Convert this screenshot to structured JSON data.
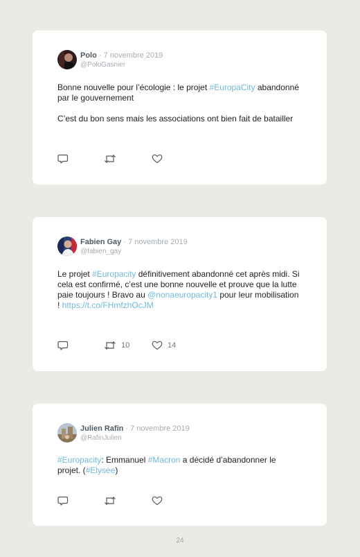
{
  "tweets": [
    {
      "name": "Polo",
      "date": "7 novembre 2019",
      "handle": "@PoloGasnier",
      "paragraphs": [
        [
          {
            "t": "Bonne nouvelle pour l’écologie : le projet "
          },
          {
            "t": "#EuropaCity",
            "link": true
          },
          {
            "t": " abandonné par le gouvernement"
          }
        ],
        [
          {
            "t": "C’est du bon sens mais les associations ont bien fait de batailler"
          }
        ]
      ],
      "retweets": "",
      "likes": ""
    },
    {
      "name": "Fabien Gay",
      "date": "7 novembre 2019",
      "handle": "@fabien_gay",
      "paragraphs": [
        [
          {
            "t": "Le projet "
          },
          {
            "t": "#Europacity",
            "link": true
          },
          {
            "t": " définitivement abandonné cet après midi. Si cela est confirmé, c’est une bonne nouvelle et prouve que la lutte paie toujours ! Bravo au "
          },
          {
            "t": "@nonaeuropacity1",
            "link": true
          },
          {
            "t": " pour leur mobilisation ! "
          },
          {
            "t": "https://t.co/FHmfzhOcJM",
            "link": true
          }
        ]
      ],
      "retweets": "10",
      "likes": "14"
    },
    {
      "name": "Julien Rafin",
      "date": "7 novembre 2019",
      "handle": "@RafinJulien",
      "paragraphs": [
        [
          {
            "t": "#Europacity",
            "link": true
          },
          {
            "t": ": Emmanuel "
          },
          {
            "t": "#Macron",
            "link": true
          },
          {
            "t": " a décidé d’abandonner le projet. ("
          },
          {
            "t": "#Elysée",
            "link": true
          },
          {
            "t": ")"
          }
        ]
      ],
      "retweets": "",
      "likes": ""
    }
  ],
  "separator": "·",
  "page_number": "24",
  "icons": {
    "reply": "reply-icon",
    "retweet": "retweet-icon",
    "like": "heart-icon"
  },
  "colors": {
    "link": "#6fb9e0",
    "background": "#ebebe6",
    "card": "#ffffff"
  }
}
